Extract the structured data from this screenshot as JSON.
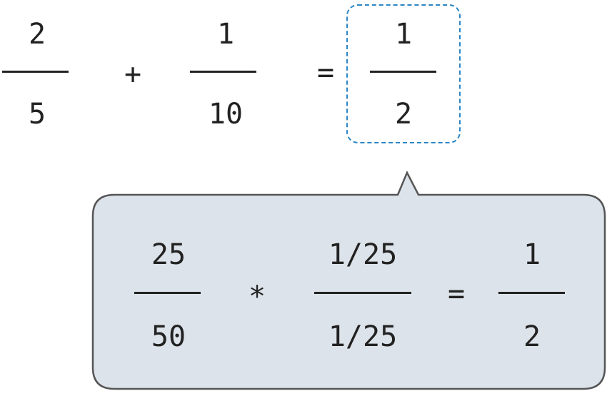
{
  "top_equation": {
    "term1": {
      "numerator": "2",
      "denominator": "5"
    },
    "operator": "+",
    "term2": {
      "numerator": "1",
      "denominator": "10"
    },
    "equals": "=",
    "result": {
      "numerator": "1",
      "denominator": "2"
    }
  },
  "callout": {
    "term1": {
      "numerator": "25",
      "denominator": "50"
    },
    "operator": "*",
    "term2": {
      "numerator": "1/25",
      "denominator": "1/25"
    },
    "equals": "=",
    "result": {
      "numerator": "1",
      "denominator": "2"
    }
  },
  "colors": {
    "highlight_border": "#2b86c5",
    "callout_fill": "#dde3ea",
    "callout_border": "#555555"
  }
}
